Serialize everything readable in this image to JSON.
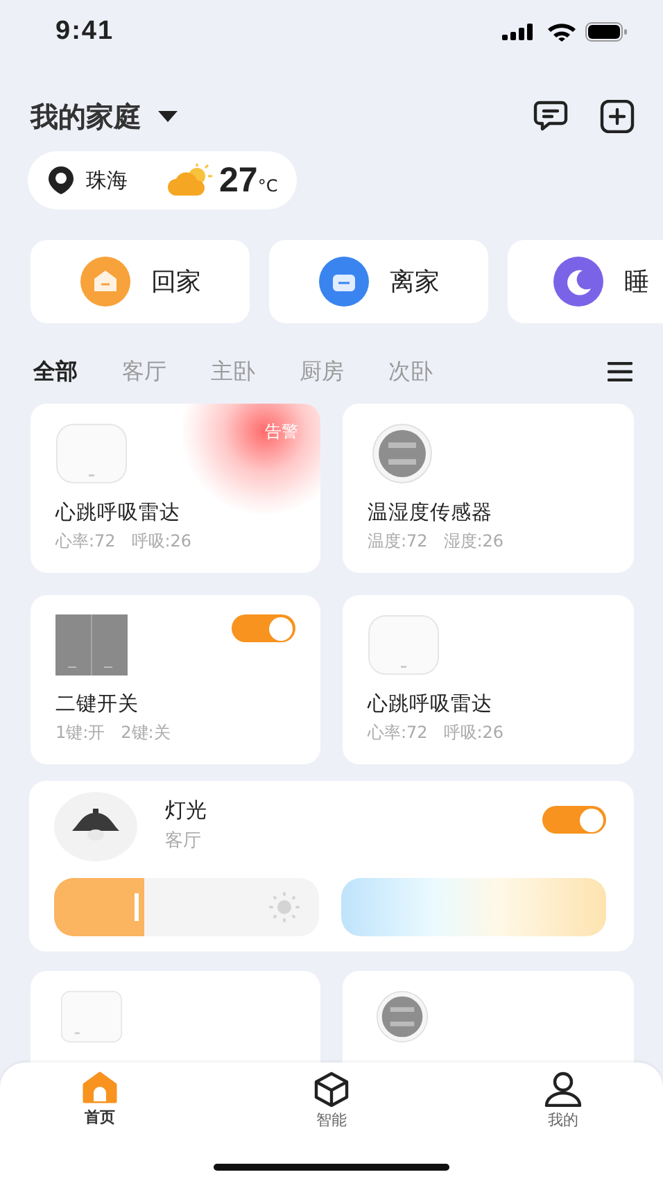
{
  "status_bar": {
    "time": "9:41"
  },
  "header": {
    "title": "我的家庭"
  },
  "location": {
    "city": "珠海",
    "temperature": "27",
    "unit": "°C"
  },
  "scenes": [
    {
      "label": "回家",
      "kind": "home"
    },
    {
      "label": "离家",
      "kind": "away"
    },
    {
      "label": "睡",
      "kind": "sleep"
    }
  ],
  "room_tabs": [
    {
      "label": "全部",
      "selected": true
    },
    {
      "label": "客厅",
      "selected": false
    },
    {
      "label": "主卧",
      "selected": false
    },
    {
      "label": "厨房",
      "selected": false
    },
    {
      "label": "次卧",
      "selected": false
    }
  ],
  "devices": [
    {
      "kind": "radar",
      "name": "心跳呼吸雷达",
      "status": "心率:72   呼吸:26",
      "alert": "告警"
    },
    {
      "kind": "thermo",
      "name": "温湿度传感器",
      "status": "温度:72   湿度:26"
    },
    {
      "kind": "switch",
      "name": "二键开关",
      "status": "1键:开   2键:关",
      "on": true
    },
    {
      "kind": "radar",
      "name": "心跳呼吸雷达",
      "status": "心率:72   呼吸:26"
    }
  ],
  "light": {
    "name": "灯光",
    "room": "客厅",
    "on": true,
    "level": 0.34
  },
  "more_devices": [
    {
      "kind": "hub"
    },
    {
      "kind": "thermo"
    }
  ],
  "bottom_nav": [
    {
      "label": "首页",
      "kind": "home",
      "selected": true
    },
    {
      "label": "智能",
      "kind": "cube",
      "selected": false
    },
    {
      "label": "我的",
      "kind": "person",
      "selected": false
    }
  ]
}
